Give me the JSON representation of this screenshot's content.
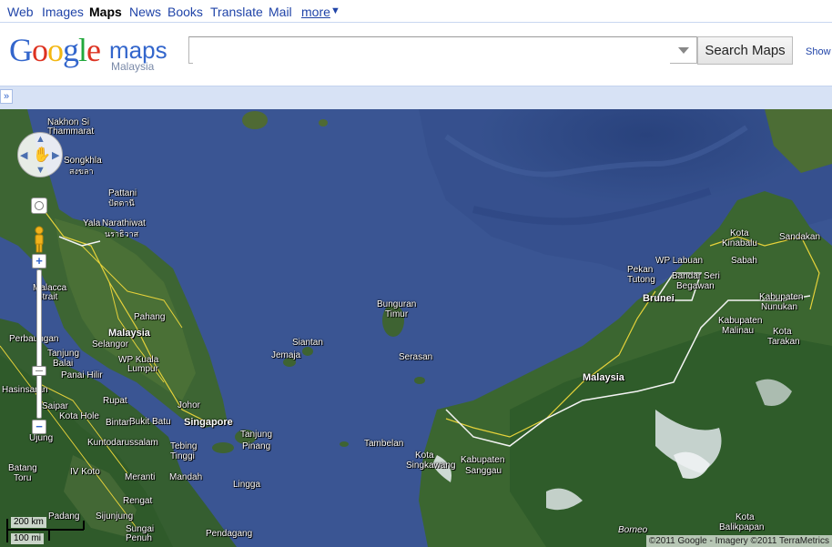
{
  "topnav": {
    "links": [
      "Web",
      "Images",
      "Maps",
      "News",
      "Books",
      "Translate",
      "Mail"
    ],
    "more": "more",
    "active": "Maps"
  },
  "header": {
    "logo_google": "Google",
    "logo_maps": "maps",
    "logo_region": "Malaysia",
    "search_value": "",
    "search_button": "Search Maps",
    "show_link": "Show"
  },
  "panel": {
    "expand": "»"
  },
  "map": {
    "labels": {
      "nakhon_si": "Nakhon Si",
      "thammarat": "Thammarat",
      "songkhla": "Songkhla",
      "songkhla_th": "สงขลา",
      "pattani": "Pattani",
      "pattani_th": "ปัตตานี",
      "yala": "Yala",
      "narathiwat": "Narathiwat",
      "narathiwat_th": "นราธิวาส",
      "malacca": "Malacca",
      "strait": "Strait",
      "pahang": "Pahang",
      "malaysia_west": "Malaysia",
      "selangor": "Selangor",
      "wp_kuala": "WP Kuala",
      "lumpur": "Lumpur",
      "tanjung": "Tanjung",
      "balai": "Balai",
      "panai_hilir": "Panai Hilir",
      "perbaungan": "Perbaungan",
      "rupat": "Rupat",
      "johor": "Johor",
      "singapore": "Singapore",
      "bukit_batu": "Bukit Batu",
      "tanjung_pinang_1": "Tanjung",
      "tanjung_pinang_2": "Pinang",
      "saipar": "Saipar",
      "kota_hole": "Kota Hole",
      "bintan": "Bintan",
      "ujung": "Ujung",
      "kuntodarussalam": "Kuntodarussalam",
      "tebing": "Tebing",
      "tinggi": "Tinggi",
      "hasinsaran": "Hasinsaran",
      "batang": "Batang",
      "toru": "Toru",
      "iv_koto": "IV Koto",
      "merenti": "Meranti",
      "mandah": "Mandah",
      "lingga": "Lingga",
      "rengat": "Rengat",
      "padang": "Padang",
      "sijunjung": "Sijunjung",
      "sungai": "Sungai",
      "penuh": "Penuh",
      "pendagang": "Pendagang",
      "bunguran": "Bunguran",
      "timur": "Timur",
      "siantan": "Siantan",
      "jemaja": "Jemaja",
      "serasan": "Serasan",
      "tambelan": "Tambelan",
      "kota_singkawang_1": "Kota",
      "kota_singkawang_2": "Singkawang",
      "kabupaten_sanggau_1": "Kabupaten",
      "kabupaten_sanggau_2": "Sanggau",
      "malaysia_east": "Malaysia",
      "borneo": "Borneo",
      "kota_balikpapan_1": "Kota",
      "kota_balikpapan_2": "Balikpapan",
      "pekan_tutong_1": "Pekan",
      "pekan_tutong_2": "Tutong",
      "brunei": "Brunei",
      "wp_labuan": "WP Labuan",
      "bandar_seri_1": "Bandar Seri",
      "bandar_seri_2": "Begawan",
      "kota_kinabalu_1": "Kota",
      "kota_kinabalu_2": "Kinabalu",
      "sandakan": "Sandakan",
      "sabah": "Sabah",
      "kabupaten_nunukan_1": "Kabupaten",
      "kabupaten_nunukan_2": "Nunukan",
      "kabupaten_malinau_1": "Kabupaten",
      "kabupaten_malinau_2": "Malinau",
      "kota_tarakan_1": "Kota",
      "kota_tarakan_2": "Tarakan"
    },
    "scale": {
      "km": "200 km",
      "mi": "100 mi"
    },
    "copyright": "©2011 Google - Imagery ©2011 TerraMetrics"
  }
}
